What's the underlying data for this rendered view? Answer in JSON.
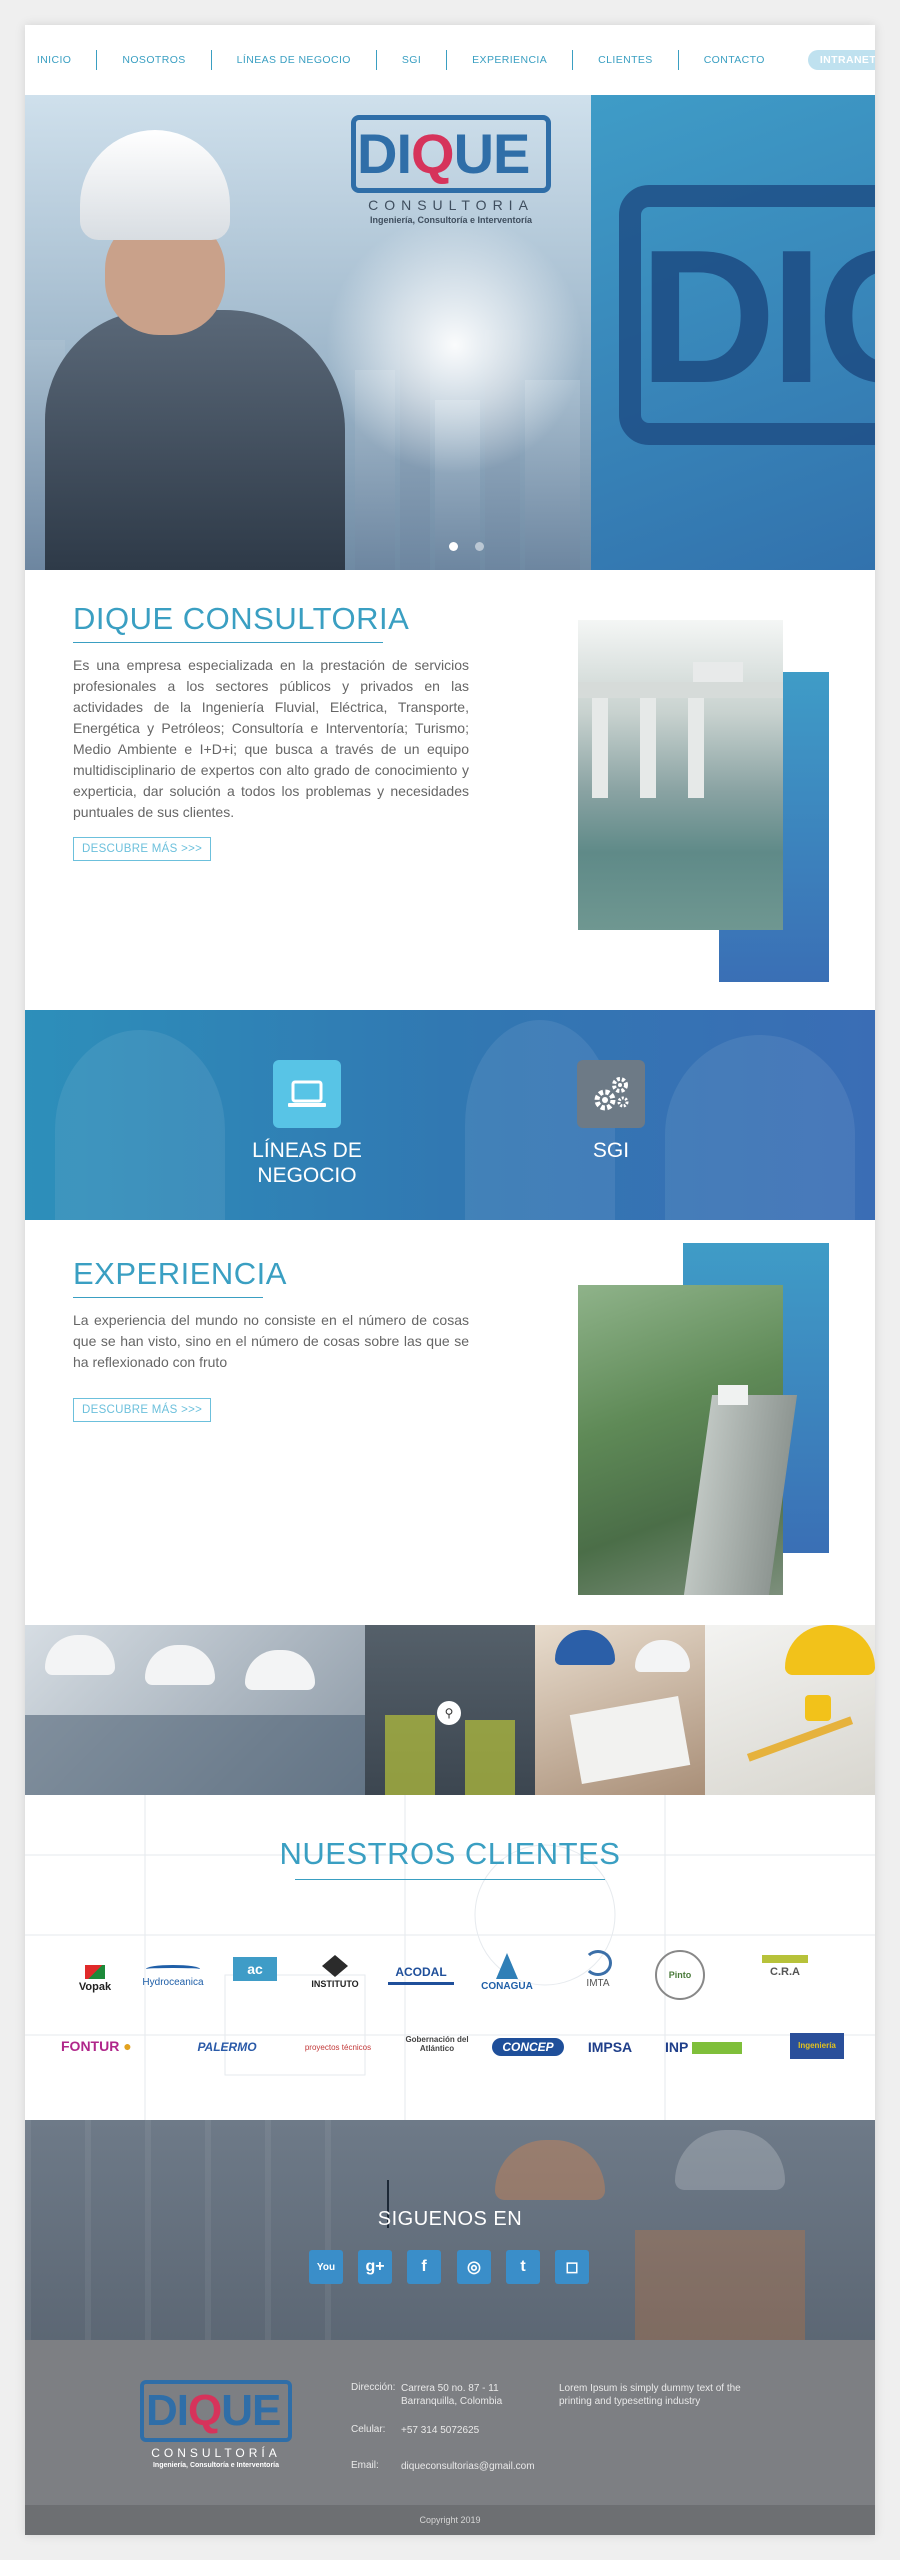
{
  "nav": {
    "items": [
      "INICIO",
      "NOSOTROS",
      "LÍNEAS DE NEGOCIO",
      "SGI",
      "EXPERIENCIA",
      "CLIENTES",
      "CONTACTO"
    ],
    "intranet": "INTRANET"
  },
  "hero": {
    "logo_word_1": "DI",
    "logo_word_q": "Q",
    "logo_word_2": "UE",
    "logo_sub": "CONSULTORIA",
    "logo_tag": "Ingeniería, Consultoría e Interventoría",
    "big_text": "DIQ",
    "slides": 2,
    "active_slide": 1
  },
  "about": {
    "title": "DIQUE CONSULTORIA",
    "text": "Es una empresa especializada en la prestación de servicios profesionales a los sectores públicos y privados en las actividades de la Ingeniería Fluvial, Eléctrica, Transporte, Energética y Petróleos; Consultoría e Interventoría; Turismo; Medio Ambiente e I+D+i; que busca a través de un equipo multidisciplinario de expertos con alto grado de conocimiento y experticia, dar solución a todos los problemas y necesidades puntuales de sus clientes.",
    "cta": "DESCUBRE MÁS >>>"
  },
  "banner": {
    "lineas": "LÍNEAS DE NEGOCIO",
    "sgi": "SGI"
  },
  "experiencia": {
    "title": "EXPERIENCIA",
    "text": "La experiencia del mundo no consiste en el número de cosas que se han visto, sino en el número de cosas sobre las que se ha reflexionado con fruto",
    "cta": "DESCUBRE MÁS >>>"
  },
  "clients": {
    "title": "NUESTROS CLIENTES",
    "row1": [
      "Vopak",
      "Hydroceanica",
      "ac",
      "INSTITUTO",
      "ACODAL",
      "CONAGUA",
      "IMTA",
      "Pinto",
      "C.R.A"
    ],
    "row2": [
      "FONTUR",
      "PALERMO",
      "proyectos técnicos",
      "Gobernación del Atlántico",
      "CONCEP",
      "IMPSA",
      "INP",
      "Ingeniería"
    ]
  },
  "follow": {
    "title": "SIGUENOS EN",
    "icons": [
      "youtube-icon",
      "google-plus-icon",
      "facebook-icon",
      "dribbble-icon",
      "twitter-icon",
      "instagram-icon"
    ],
    "glyphs": [
      "You",
      "g+",
      "f",
      "◎",
      "t",
      "◻"
    ]
  },
  "footer": {
    "direccion_label": "Dirección:",
    "direccion_1": "Carrera 50 no. 87 - 11",
    "direccion_2": "Barranquilla, Colombia",
    "celular_label": "Celular:",
    "celular": "+57 314 5072625",
    "email_label": "Email:",
    "email": "diqueconsultorias@gmail.com",
    "lorem": "Lorem Ipsum is simply dummy text of the printing and typesetting industry",
    "logo_word_1": "DI",
    "logo_word_q": "Q",
    "logo_word_2": "UE",
    "logo_sub": "CONSULTORÍA",
    "logo_tag": "Ingeniería, Consultoría e Interventoría",
    "copyright": "Copyright 2019"
  },
  "colors": {
    "accent": "#3a9fc2",
    "blue": "#3178b2",
    "footer": "#7d7f83",
    "logo_red": "#d6335b"
  }
}
